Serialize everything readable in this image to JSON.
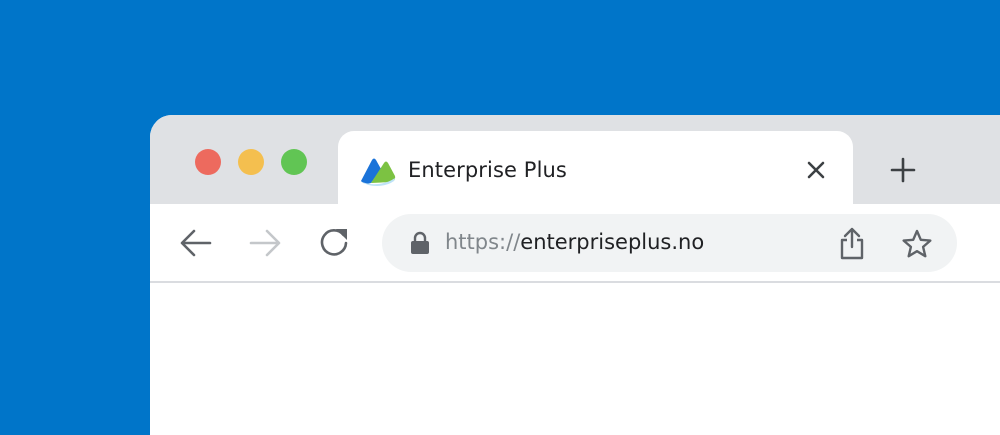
{
  "window_controls": {
    "close_color": "#ed6a5e",
    "minimize_color": "#f4bf4f",
    "zoom_color": "#61c554"
  },
  "tab": {
    "favicon": "enterprise-plus-logo",
    "title": "Enterprise Plus",
    "close_icon": "close-icon"
  },
  "new_tab": {
    "icon": "plus-icon"
  },
  "toolbar": {
    "back_icon": "arrow-left-icon",
    "forward_icon": "arrow-right-icon",
    "reload_icon": "reload-icon"
  },
  "address_bar": {
    "lock_icon": "lock-icon",
    "scheme": "https://",
    "host": "enterpriseplus.no",
    "share_icon": "share-icon",
    "bookmark_icon": "star-icon"
  },
  "colors": {
    "background": "#0075c9",
    "tabstrip": "#dfe1e4",
    "omnibox": "#f1f3f4"
  }
}
